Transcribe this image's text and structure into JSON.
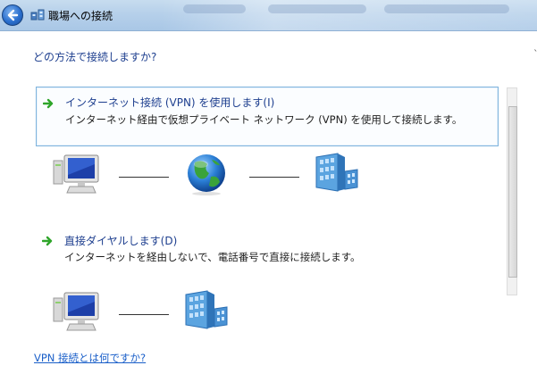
{
  "window": {
    "title": "職場への接続"
  },
  "prompt": {
    "question": "どの方法で接続しますか?"
  },
  "options": [
    {
      "title": "インターネット接続 (VPN) を使用します(I)",
      "description": "インターネット経由で仮想プライベート ネットワーク (VPN) を使用して接続します。",
      "selected": true
    },
    {
      "title": "直接ダイヤルします(D)",
      "description": "インターネットを経由しないで、電話番号で直接に接続します。",
      "selected": false
    }
  ],
  "diagrams": {
    "vpn": [
      "computer-icon",
      "globe-icon",
      "office-building-icon"
    ],
    "dial": [
      "computer-icon",
      "office-building-icon"
    ]
  },
  "help": {
    "link": "VPN 接続とは何ですか?"
  },
  "colors": {
    "accent_blue": "#1e3f8f",
    "link_blue": "#1a5fc9",
    "arrow_green": "#2fa52a",
    "selection_border": "#7fb4dd"
  }
}
